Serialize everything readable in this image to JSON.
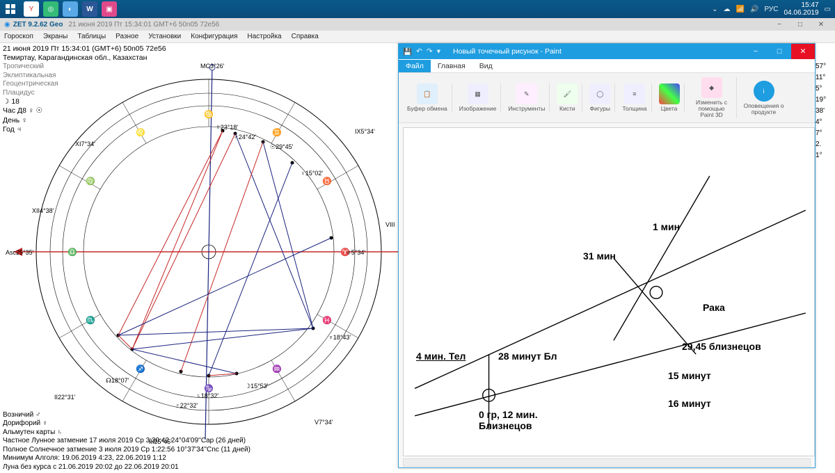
{
  "taskbar": {
    "lang": "РУС",
    "time": "15:47",
    "date": "04.06.2019"
  },
  "zet": {
    "title_app": "ZET 9.2.62 Geo",
    "title_detail": "21 июня 2019  Пт  15:34:01 GMT+6 50n05  72e56",
    "menu": [
      "Гороскоп",
      "Экраны",
      "Таблицы",
      "Разное",
      "Установки",
      "Конфигурация",
      "Настройка",
      "Справка"
    ],
    "head": {
      "l1": "21 июня 2019  Пт  15:34:01 (GMT+6) 50n05  72e56",
      "l2": "Темиртау, Карагандинская обл., Казахстан",
      "s1": "Тропический",
      "s2": "Эклиптикальная",
      "s3": "Геоцентрическая",
      "s4": "Плацидус",
      "s5": "☽  18",
      "s6": "Час Д8 ♀ ☉",
      "s7": "День ♀",
      "s8": "Год ♃"
    },
    "chart_labels": {
      "asc": "Asc25°35'",
      "mc": "MC3°26'",
      "h2": "II22°31'",
      "h3": "III25°45'",
      "h5": "V7°34'",
      "h8": "VIII",
      "h9": "IX5°34'",
      "h11": "XI7°34'",
      "h12": "XII4°38'",
      "merc": "☿23°18'",
      "mars": "♂24°42'",
      "sun": "☉29°45'",
      "venus": "♀15°02'",
      "uran": "♅5°34'",
      "nep": "♆18°43'",
      "moon": "☽15°53'",
      "sat": "♄18°32'",
      "plut": "♇22°32'",
      "node": "☊18°07'"
    },
    "foot": {
      "l1": "Возничий ♂",
      "l2": "Дорифорий ♀",
      "l3": "Альмутен карты ♄",
      "l4": "Частное Лунное затмение 17 июля 2019 Ср  3:30:42 24°04'09''Cap (26 дней)",
      "l5": "Полное Солнечное затмение 3 июля 2019 Ср  1:22:56 10°37'34''Cnc (11 дней)",
      "l6": "Минимум Алголя: 19.06.2019  4:23,  22.06.2019  1:12",
      "l7": "Луна без курса с 21.06.2019 20:02 до 22.06.2019 20:01"
    },
    "datacol": [
      "57°",
      "11°",
      "5°",
      "19°",
      "38'",
      "4°",
      "7°",
      "2.",
      "1°"
    ]
  },
  "paint": {
    "title": "Новый точечный рисунок - Paint",
    "tabs": {
      "file": "Файл",
      "home": "Главная",
      "view": "Вид"
    },
    "ribbon": {
      "clipboard": "Буфер\nобмена",
      "image": "Изображение",
      "tools": "Инструменты",
      "brushes": "Кисти",
      "shapes": "Фигуры",
      "thickness": "Толщина",
      "colors": "Цвета",
      "paint3d": "Изменить с\nпомощью Paint 3D",
      "alerts": "Оповещения\nо продукте"
    },
    "labels": {
      "l1": "1 мин",
      "l31": "31 мин",
      "raka": "Рака",
      "bl2945": "29,45 близнецов",
      "m15": "15 минут",
      "m16": "16 минут",
      "tl4": "4 мин. Тел",
      "bl28": "28 минут Бл",
      "bl0": "0 гр, 12 мин.\nБлизнецов"
    }
  }
}
